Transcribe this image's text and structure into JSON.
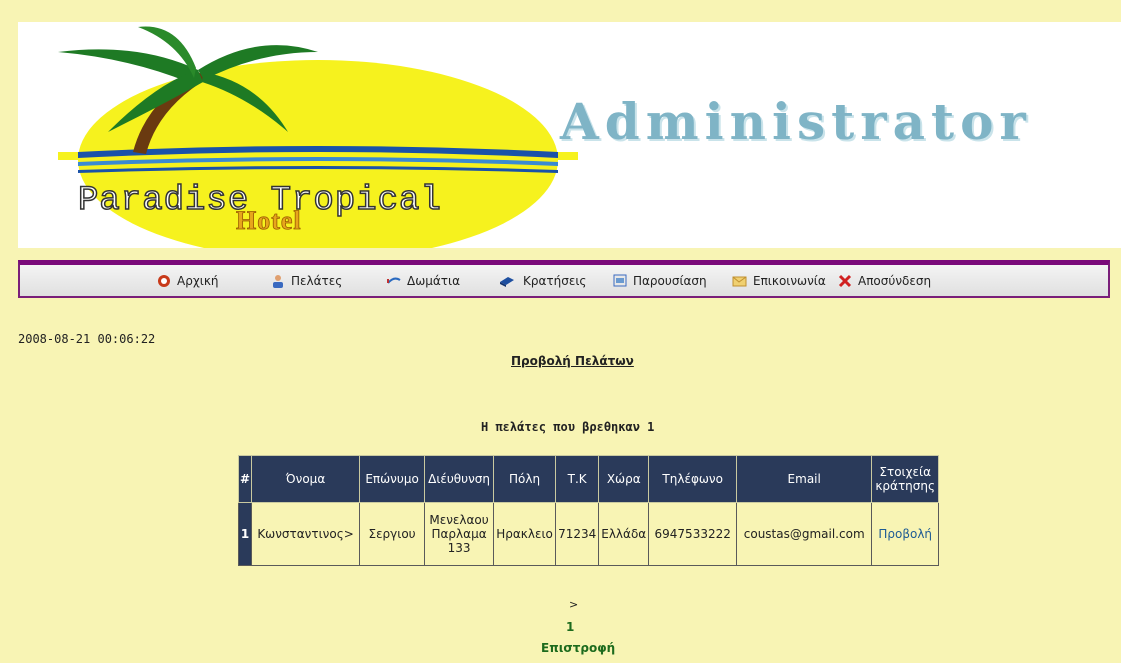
{
  "banner": {
    "title": "Administrator",
    "logo_text": "Paradise Tropical",
    "logo_sub": "Hotel"
  },
  "nav": [
    {
      "label": "Αρχική",
      "icon": "home-icon"
    },
    {
      "label": "Πελάτες",
      "icon": "customers-icon"
    },
    {
      "label": "Δωμάτια",
      "icon": "rooms-icon"
    },
    {
      "label": "Κρατήσεις",
      "icon": "bookings-icon"
    },
    {
      "label": "Παρουσίαση",
      "icon": "presentation-icon"
    },
    {
      "label": "Επικοινωνία",
      "icon": "contact-icon"
    },
    {
      "label": "Αποσύνδεση",
      "icon": "logout-icon"
    }
  ],
  "timestamp": "2008-08-21 00:06:22",
  "section_title": "Προβολή Πελάτων",
  "results_text": "Η πελάτες που βρεθηκαν 1",
  "table": {
    "headers": [
      "#",
      "Όνομα",
      "Επώνυμο",
      "Διέυθυνση",
      "Πόλη",
      "Τ.Κ",
      "Χώρα",
      "Τηλέφωνο",
      "Email",
      "Στοιχεία κράτησης"
    ],
    "rows": [
      [
        "1",
        "Κωνσταντινος>",
        "Σεργιου",
        "Μενελαου Παρλαμα 133",
        "Ηρακλειο",
        "71234",
        "Ελλάδα",
        "6947533222",
        "coustas@gmail.com",
        "Προβολή"
      ]
    ]
  },
  "pager": {
    "arrow": ">",
    "page": "1"
  },
  "back_link": "Επιστροφή",
  "colors": {
    "background": "#f8f4b4",
    "header": "#2a3a5a",
    "nav_border": "#7a0a7a",
    "link": "#1d6b1d"
  }
}
